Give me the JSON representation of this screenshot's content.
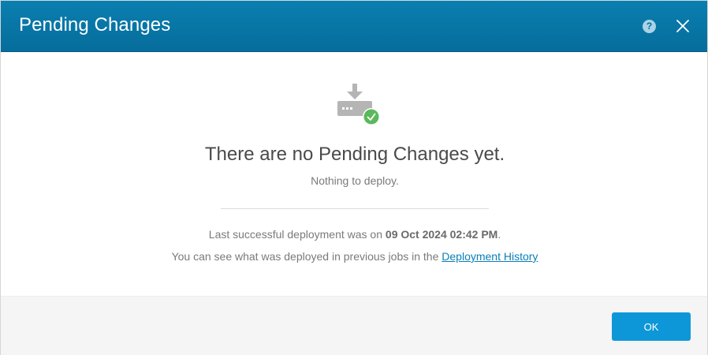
{
  "dialog": {
    "title": "Pending Changes",
    "help_label": "?",
    "close_label": "close"
  },
  "body": {
    "icon": "deploy-download-check-icon",
    "main_message": "There are no Pending Changes yet.",
    "sub_message": "Nothing to deploy.",
    "last_deploy_prefix": "Last successful deployment was on ",
    "last_deploy_date": "09 Oct 2024 02:42 PM",
    "last_deploy_suffix": ".",
    "history_prefix": "You can see what was deployed in previous jobs in the ",
    "history_link": "Deployment History"
  },
  "footer": {
    "ok_label": "OK"
  },
  "colors": {
    "header_bg": "#0a7fb0",
    "primary_button": "#0d97d8",
    "link": "#0a7fb8",
    "success_green": "#5cb85c",
    "icon_gray": "#b5b5b5"
  }
}
